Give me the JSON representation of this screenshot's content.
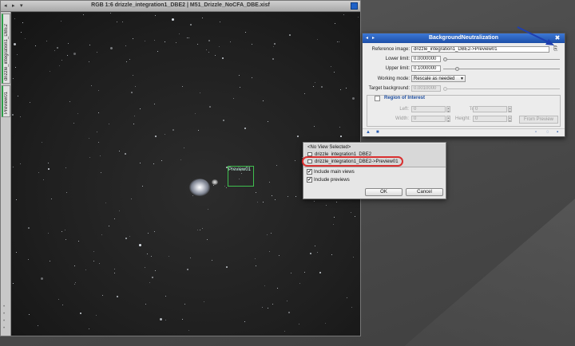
{
  "image_window": {
    "title": "RGB 1:6 drizzle_integration1_DBE2 | M51_Drizzle_NoCFA_DBE.xisf",
    "controls": [
      "◂",
      "▸",
      "▾"
    ],
    "side_tabs": [
      "drizzle_integration1_DBE2",
      "Preview01"
    ],
    "preview_label": "Preview01"
  },
  "dialog": {
    "title": "BackgroundNeutralization",
    "reference_image": {
      "label": "Reference image:",
      "value": "drizzle_integration1_DBE2->Preview01"
    },
    "lower_limit": {
      "label": "Lower limit:",
      "value": "0.0000000",
      "level": 0.0
    },
    "upper_limit": {
      "label": "Upper limit:",
      "value": "0.1000000",
      "level": 0.1
    },
    "working_mode": {
      "label": "Working mode:",
      "value": "Rescale as needed"
    },
    "target_background": {
      "label": "Target background:",
      "value": "0.0010000"
    },
    "roi": {
      "title": "Region of Interest",
      "left": {
        "label": "Left:",
        "value": "0"
      },
      "top": {
        "label": "Top:",
        "value": "0"
      },
      "width": {
        "label": "Width:",
        "value": "0"
      },
      "height": {
        "label": "Height:",
        "value": "0"
      },
      "from_preview": "From Preview"
    }
  },
  "view_popup": {
    "items": [
      "<No View Selected>",
      "drizzle_integration1_DBE2",
      "drizzle_integration1_DBE2->Preview01"
    ],
    "include_main_views": "Include main views",
    "include_previews": "Include previews",
    "ok": "OK",
    "cancel": "Cancel"
  },
  "colors": {
    "titlebar_blue": "#1d4fa8",
    "preview_green": "#3fbf4f",
    "annotation_red": "#d93030",
    "annotation_arrow": "#1f3fb0"
  }
}
